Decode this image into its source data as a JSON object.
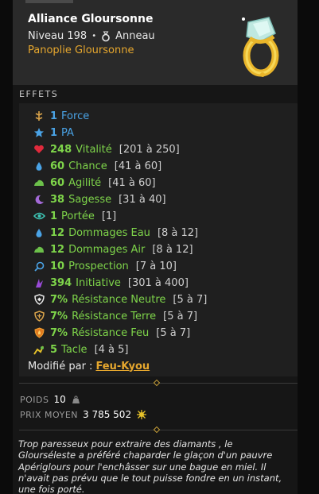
{
  "item": {
    "name": "Alliance Gloursonne",
    "level": "Niveau 198",
    "bullet": "•",
    "type": "Anneau",
    "set": "Panoplie Gloursonne",
    "icon": "ring-icon",
    "image": "ring-item-image"
  },
  "effects": {
    "label": "EFFETS",
    "items": [
      {
        "value": "1",
        "stat": "Force",
        "range": "",
        "icon": "force-icon",
        "color": "#4aa3e6"
      },
      {
        "value": "1",
        "stat": "PA",
        "range": "",
        "icon": "star-pa-icon",
        "color": "#4aa3e6"
      },
      {
        "value": "248",
        "stat": "Vitalité",
        "range": "[201 à 250]",
        "icon": "heart-icon",
        "color": "#7ed44a"
      },
      {
        "value": "60",
        "stat": "Chance",
        "range": "[41 à 60]",
        "icon": "water-drop-icon",
        "color": "#7ed44a"
      },
      {
        "value": "60",
        "stat": "Agilité",
        "range": "[41 à 60]",
        "icon": "air-icon",
        "color": "#7ed44a"
      },
      {
        "value": "38",
        "stat": "Sagesse",
        "range": "[31 à 40]",
        "icon": "moon-icon",
        "color": "#7ed44a"
      },
      {
        "value": "1",
        "stat": "Portée",
        "range": "[1]",
        "icon": "eye-icon",
        "color": "#7ed44a"
      },
      {
        "value": "12",
        "stat": "Dommages Eau",
        "range": "[8 à 12]",
        "icon": "water-drop-icon",
        "color": "#7ed44a"
      },
      {
        "value": "12",
        "stat": "Dommages Air",
        "range": "[8 à 12]",
        "icon": "air-icon",
        "color": "#7ed44a"
      },
      {
        "value": "10",
        "stat": "Prospection",
        "range": "[7 à 10]",
        "icon": "magnifier-icon",
        "color": "#7ed44a"
      },
      {
        "value": "394",
        "stat": "Initiative",
        "range": "[301 à 400]",
        "icon": "initiative-icon",
        "color": "#7ed44a"
      },
      {
        "value": "7%",
        "stat": "Résistance Neutre",
        "range": "[5 à 7]",
        "icon": "shield-neutral-icon",
        "color": "#7ed44a"
      },
      {
        "value": "7%",
        "stat": "Résistance Terre",
        "range": "[5 à 7]",
        "icon": "shield-earth-icon",
        "color": "#7ed44a"
      },
      {
        "value": "7%",
        "stat": "Résistance Feu",
        "range": "[5 à 7]",
        "icon": "shield-fire-icon",
        "color": "#7ed44a"
      },
      {
        "value": "5",
        "stat": "Tacle",
        "range": "[4 à 5]",
        "icon": "tackle-icon",
        "color": "#7ed44a"
      }
    ],
    "modified_by_label": "Modifié par :",
    "modified_by": "Feu-Kyou"
  },
  "stats": {
    "weight_label": "POIDS",
    "weight_value": "10",
    "price_label": "PRIX MOYEN",
    "price_value": "3 785 502",
    "kamas_icon": "kamas-icon"
  },
  "description": "Trop paresseux pour extraire des diamants , le Glourséleste a préféré chaparder le glaçon d'un pauvre Apériglours pour l'enchâsser sur une bague en miel. Il n'avait pas prévu que le tout puisse fondre en un instant, une fois porté."
}
